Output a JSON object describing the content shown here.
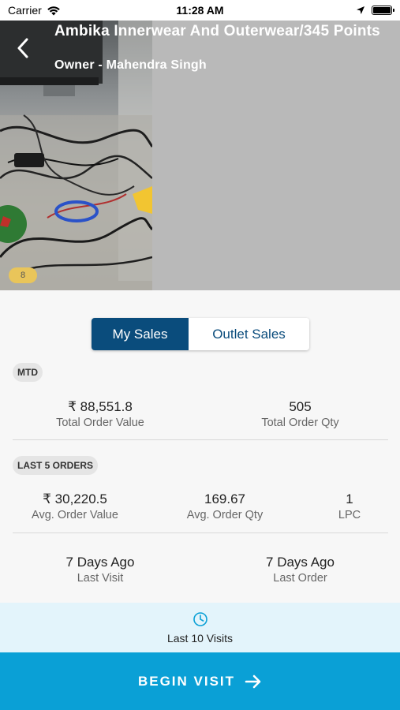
{
  "status_bar": {
    "carrier": "Carrier",
    "time": "11:28 AM"
  },
  "header": {
    "title": "Ambika Innerwear And Outerwear/345 Points",
    "owner": "Owner - Mahendra Singh",
    "photo_count": "8"
  },
  "tabs": {
    "my_sales": "My Sales",
    "outlet_sales": "Outlet Sales",
    "active": "My Sales"
  },
  "mtd": {
    "tag": "MTD",
    "total_order_value": "₹ 88,551.8",
    "total_order_value_label": "Total Order Value",
    "total_order_qty": "505",
    "total_order_qty_label": "Total Order Qty"
  },
  "last_orders": {
    "tag": "LAST 5 ORDERS",
    "avg_order_value": "₹ 30,220.5",
    "avg_order_value_label": "Avg. Order Value",
    "avg_order_qty": "169.67",
    "avg_order_qty_label": "Avg. Order Qty",
    "lpc": "1",
    "lpc_label": "LPC"
  },
  "recency": {
    "last_visit": "7 Days Ago",
    "last_visit_label": "Last Visit",
    "last_order": "7 Days Ago",
    "last_order_label": "Last Order"
  },
  "visits": {
    "label": "Last 10 Visits",
    "icon": "clock-icon"
  },
  "begin_visit": {
    "label": "BEGIN VISIT",
    "icon": "arrow-right-icon"
  },
  "colors": {
    "primary": "#0a4c7c",
    "accent": "#0aa0d6",
    "visits_bg": "#e3f4fb",
    "badge": "#e9c55a"
  }
}
